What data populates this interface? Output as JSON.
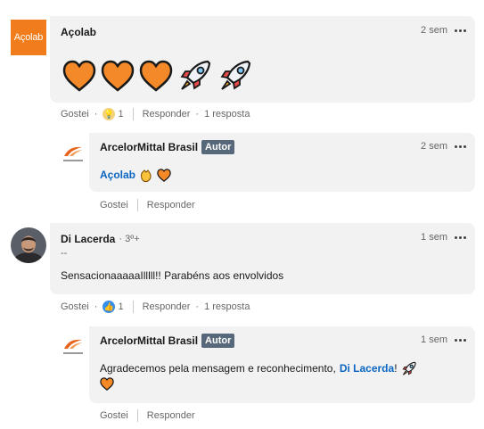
{
  "comments": [
    {
      "author": "Açolab",
      "avatar_text": "Açolab",
      "time": "2 sem",
      "reactions": [
        "orange-heart-icon",
        "orange-heart-icon",
        "orange-heart-icon",
        "rocket-icon",
        "rocket-icon"
      ],
      "actions": {
        "like": "Gostei",
        "react_count": "1",
        "reply": "Responder",
        "replies": "1 resposta"
      },
      "reply": {
        "author": "ArcelorMittal Brasil",
        "badge": "Autor",
        "time": "2 sem",
        "mention": "Açolab",
        "emojis": [
          "clapping-hands-icon",
          "orange-heart-icon"
        ],
        "actions": {
          "like": "Gostei",
          "reply": "Responder"
        }
      }
    },
    {
      "author": "Di Lacerda",
      "degree": "· 3º+",
      "subtitle": "--",
      "time": "1 sem",
      "text": "SensacionaaaaaIlllll!! Parabéns aos envolvidos",
      "actions": {
        "like": "Gostei",
        "react_count": "1",
        "reply": "Responder",
        "replies": "1 resposta"
      },
      "reply": {
        "author": "ArcelorMittal Brasil",
        "badge": "Autor",
        "time": "1 sem",
        "text": "Agradecemos pela mensagem e reconhecimento,",
        "mention": "Di Lacerda",
        "mention_suffix": "!",
        "actions": {
          "like": "Gostei",
          "reply": "Responder"
        }
      }
    }
  ],
  "colors": {
    "bubble": "#f2f2f2",
    "accent": "#0a66c2",
    "acolab_orange": "#f07c1c",
    "badge": "#56687a"
  }
}
